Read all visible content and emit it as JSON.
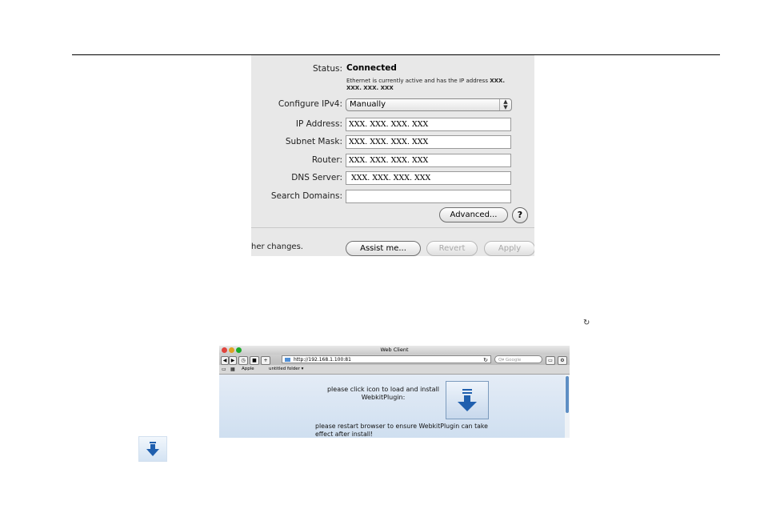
{
  "network": {
    "status_label": "Status:",
    "status_value": "Connected",
    "status_desc": "Ethernet is currently active and has the IP address",
    "status_desc_ip": "XXX. XXX. XXX. XXX",
    "configure_label": "Configure IPv4:",
    "configure_value": "Manually",
    "ip_label": "IP Address:",
    "ip_value": "XXX. XXX. XXX. XXX",
    "subnet_label": "Subnet Mask:",
    "subnet_value": "XXX. XXX. XXX. XXX",
    "router_label": "Router:",
    "router_value": "XXX. XXX. XXX. XXX",
    "dns_label": "DNS Server:",
    "dns_value": " XXX. XXX. XXX. XXX",
    "search_label": "Search Domains:",
    "search_value": "",
    "advanced_label": "Advanced...",
    "help_label": "?",
    "footer_text": "her changes.",
    "assist_label": "Assist me...",
    "revert_label": "Revert",
    "apply_label": "Apply"
  },
  "page": {
    "refresh_glyph": "↻"
  },
  "browser": {
    "title": "Web Client",
    "url": "http://192.168.1.100:81",
    "search_placeholder": "Q▾ Google",
    "bookmarks": [
      "Apple",
      "untitled folder ▾"
    ],
    "install_text_1": "please click icon to load and install",
    "install_text_2": "WebkitPlugin:",
    "restart_text_1": "please restart browser to ensure WebkitPlugin can take",
    "restart_text_2": "effect after install!"
  },
  "colors": {
    "download_arrow": "#1f5fae",
    "traffic_close": "#e0443e",
    "traffic_min": "#dea123",
    "traffic_max": "#1aab29"
  }
}
